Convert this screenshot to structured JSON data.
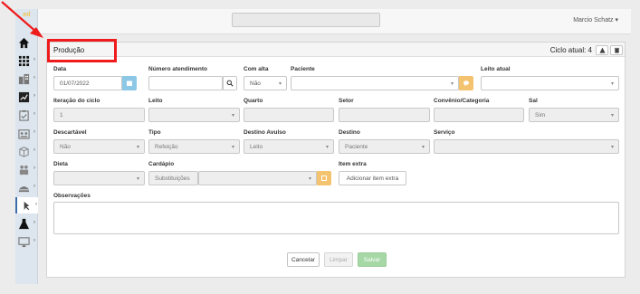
{
  "app": {
    "logo_text": "ed",
    "user": "Marcio Schatz ▾"
  },
  "panel": {
    "title": "Produção",
    "cycle": "Ciclo atual: 4"
  },
  "form": {
    "data": {
      "label": "Data",
      "value": "01/07/2022"
    },
    "numero_atendimento": {
      "label": "Número atendimento",
      "value": ""
    },
    "com_alta": {
      "label": "Com alta",
      "value": "Não"
    },
    "paciente": {
      "label": "Paciente",
      "value": ""
    },
    "leito_atual": {
      "label": "Leito atual",
      "value": ""
    },
    "iteracao": {
      "label": "Iteração do ciclo",
      "value": "1"
    },
    "leito": {
      "label": "Leito",
      "value": ""
    },
    "quarto": {
      "label": "Quarto",
      "value": ""
    },
    "setor": {
      "label": "Setor",
      "value": ""
    },
    "convenio": {
      "label": "Convênio/Categoria",
      "value": ""
    },
    "sal": {
      "label": "Sal",
      "value": "Sim"
    },
    "descartavel": {
      "label": "Descartável",
      "value": "Não"
    },
    "tipo": {
      "label": "Tipo",
      "value": "Refeição"
    },
    "destino_avulso": {
      "label": "Destino Avulso",
      "value": "Leito"
    },
    "destino": {
      "label": "Destino",
      "value": "Paciente"
    },
    "servico": {
      "label": "Serviço",
      "value": ""
    },
    "dieta": {
      "label": "Dieta",
      "value": ""
    },
    "cardapio": {
      "label": "Cardápio",
      "value": "Substituições"
    },
    "item_extra": {
      "label": "Item extra",
      "button": "Adicionar item extra"
    },
    "observacoes": {
      "label": "Observações"
    }
  },
  "actions": {
    "cancel": "Cancelar",
    "clear": "Limpar",
    "save": "Salvar"
  },
  "colors": {
    "highlight": "#ee1c1c",
    "save": "#a6d8a6",
    "calendar_addon": "#8cc7e6",
    "orange_addon": "#f4c36f"
  }
}
